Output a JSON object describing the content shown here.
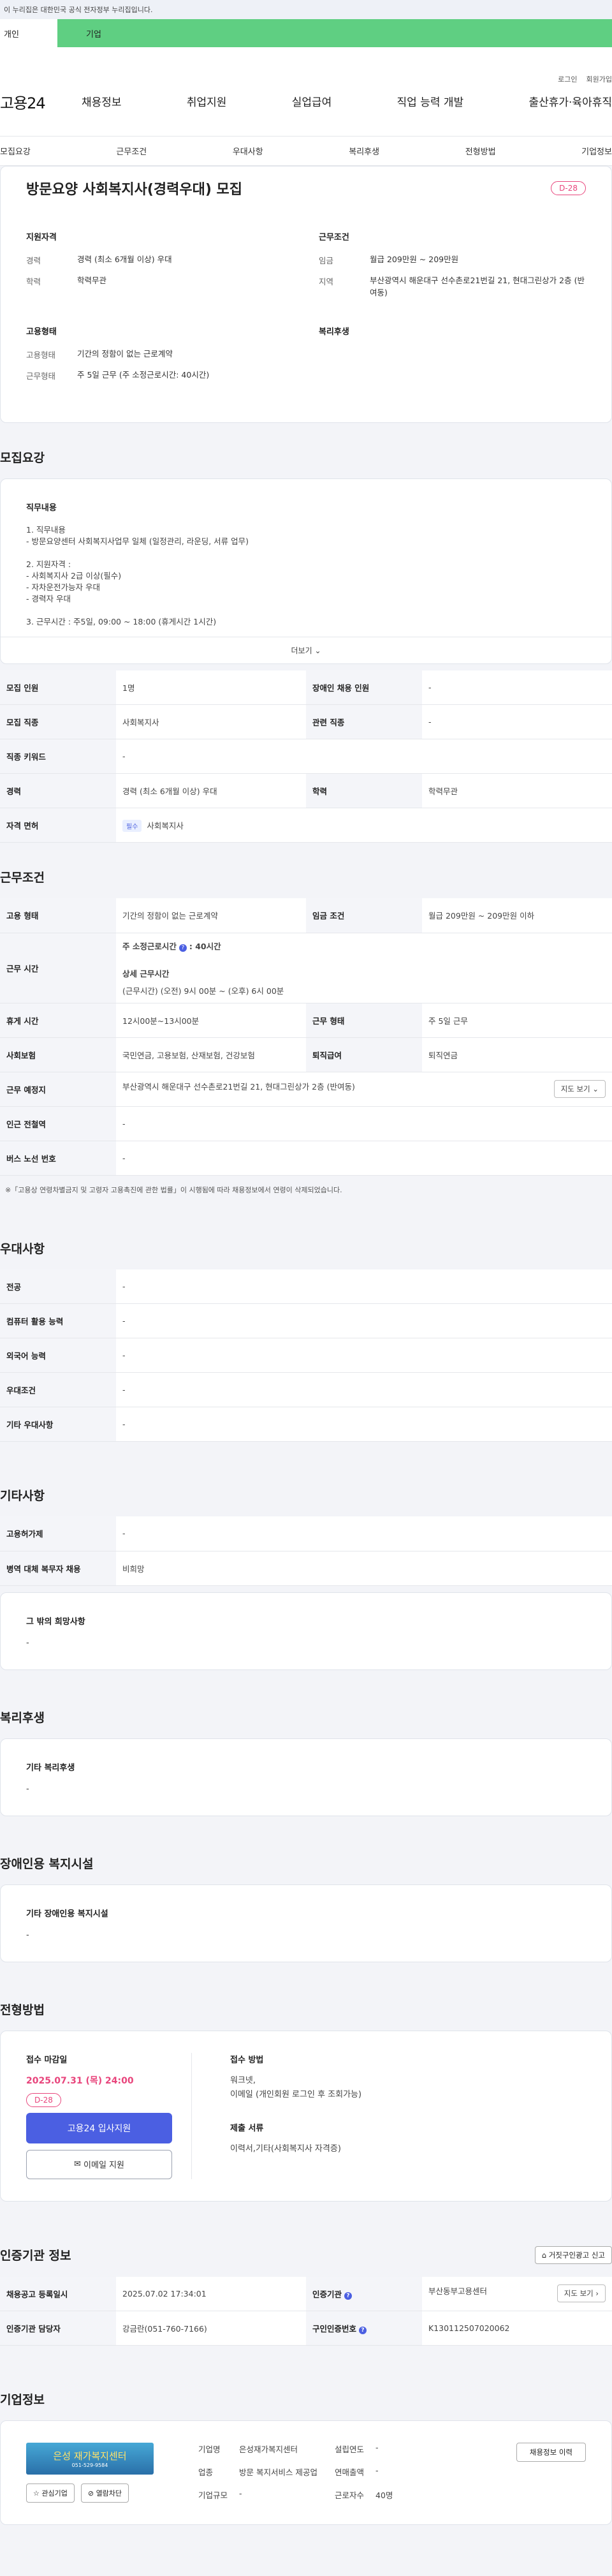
{
  "gov_bar": {
    "text": "이 누리집은 대한민국 공식 전자정부 누리집입니다."
  },
  "type_tabs": {
    "personal": "개인",
    "business": "기업"
  },
  "util": {
    "login": "로그인",
    "join": "회원가입"
  },
  "logo": "고용24",
  "gnb": [
    "채용정보",
    "취업지원",
    "실업급여",
    "직업 능력 개발",
    "출산휴가·육아휴직"
  ],
  "subnav": [
    "모집요강",
    "근무조건",
    "우대사항",
    "복리후생",
    "전형방법",
    "기업정보"
  ],
  "hero": {
    "title": "방문요양 사회복지사(경력우대) 모집",
    "dday": "D-28",
    "qualification_head": "지원자격",
    "conditions_head": "근무조건",
    "employment_head": "고용형태",
    "welfare_head": "복리후생",
    "career_k": "경력",
    "career_v": "경력 (최소 6개월 이상) 우대",
    "edu_k": "학력",
    "edu_v": "학력무관",
    "wage_k": "임금",
    "wage_v": "월급 209만원 ~ 209만원",
    "region_k": "지역",
    "region_v": "부산광역시 해운대구 선수촌로21번길 21, 현대그린상가 2층 (반여동)",
    "emp_k": "고용형태",
    "emp_v": "기간의 정함이 없는 근로계약",
    "form_k": "근무형태",
    "form_v": "주 5일 근무 (주 소정근로시간: 40시간)"
  },
  "recruit": {
    "title": "모집요강",
    "desc_head": "직무내용",
    "lines": [
      "1. 직무내용",
      "- 방문요양센터 사회복지사업무 일체 (일정관리, 라운딩, 서류 업무)",
      "",
      "2. 지원자격 :",
      "- 사회복지사 2급 이상(필수)",
      "- 자차운전가능자 우대",
      "- 경력자 우대",
      "",
      "3. 근무시간 : 주5일, 09:00 ~ 18:00 (휴게시간 1시간)"
    ],
    "more": "더보기",
    "table": {
      "count_k": "모집 인원",
      "count_v": "1명",
      "disabled_k": "장애인 채용 인원",
      "disabled_v": "-",
      "job_k": "모집 직종",
      "job_v": "사회복지사",
      "related_k": "관련 직종",
      "related_v": "-",
      "keyword_k": "직종 키워드",
      "keyword_v": "-",
      "career_k": "경력",
      "career_v": "경력 (최소 6개월 이상) 우대",
      "edu_k": "학력",
      "edu_v": "학력무관",
      "license_k": "자격 면허",
      "license_badge": "필수",
      "license_v": "사회복지사"
    }
  },
  "conditions": {
    "title": "근무조건",
    "emp_k": "고용 형태",
    "emp_v": "기간의 정함이 없는 근로계약",
    "wage_k": "임금 조건",
    "wage_v": "월급 209만원 ~ 209만원 이하",
    "time_k": "근무 시간",
    "time_week_label": "주 소정근로시간",
    "time_week_v": ": 40시간",
    "time_detail_label": "상세 근무시간",
    "time_detail_v": "(근무시간) (오전) 9시 00분 ~ (오후) 6시 00분",
    "rest_k": "휴게 시간",
    "rest_v": "12시00분~13시00분",
    "form_k": "근무 형태",
    "form_v": "주 5일 근무",
    "ins_k": "사회보험",
    "ins_v": "국민연금, 고용보험, 산재보험, 건강보험",
    "retire_k": "퇴직급여",
    "retire_v": "퇴직연금",
    "place_k": "근무 예정지",
    "place_v": "부산광역시 해운대구 선수촌로21번길 21, 현대그린상가 2층 (반여동)",
    "map_btn": "지도 보기",
    "subway_k": "인근 전철역",
    "subway_v": "-",
    "bus_k": "버스 노선 번호",
    "bus_v": "-",
    "note": "※「고용상 연령차별금지 및 고령자 고용촉진에 관한 법률」이 시행됨에 따라 채용정보에서 연령이 삭제되었습니다."
  },
  "preference": {
    "title": "우대사항",
    "major_k": "전공",
    "major_v": "-",
    "pc_k": "컴퓨터 활용 능력",
    "pc_v": "-",
    "lang_k": "외국어 능력",
    "lang_v": "-",
    "cond_k": "우대조건",
    "cond_v": "-",
    "etc_k": "기타 우대사항",
    "etc_v": "-"
  },
  "other": {
    "title": "기타사항",
    "permit_k": "고용허가제",
    "permit_v": "-",
    "military_k": "병역 대체 복무자 채용",
    "military_v": "비희망",
    "hope_head": "그 밖의 희망사항",
    "hope_v": "-"
  },
  "welfare": {
    "title": "복리후생",
    "head": "기타 복리후생",
    "v": "-"
  },
  "disabled": {
    "title": "장애인용 복지시설",
    "head": "기타 장애인용 복지시설",
    "v": "-"
  },
  "apply": {
    "title": "전형방법",
    "deadline_label": "접수 마감일",
    "deadline": "2025.07.31 (목) 24:00",
    "dday": "D-28",
    "btn_apply": "고용24 입사지원",
    "btn_email": "이메일 지원",
    "method_label": "접수 방법",
    "method_lines": [
      "워크넷,",
      "이메일 (개인회원 로그인 후 조회가능)"
    ],
    "docs_label": "제출 서류",
    "docs_v": "이력서,기타(사회복지사 자격증)"
  },
  "agency": {
    "title": "인증기관 정보",
    "report_btn": "거짓구인광고 신고",
    "reg_k": "채용공고 등록일시",
    "reg_v": "2025.07.02 17:34:01",
    "org_k": "인증기관",
    "org_v": "부산동부고용센터",
    "map_btn": "지도 보기",
    "person_k": "인증기관 담당자",
    "person_v": "강금란(051-760-7166)",
    "id_k": "구인인증번호",
    "id_v": "K130112507020062"
  },
  "company": {
    "title": "기업정보",
    "logo_main": "은성 재가복지센터",
    "logo_sub": "051-529-9584",
    "btn_interest": "관심기업",
    "btn_block": "열람차단",
    "name_k": "기업명",
    "name_v": "은성재가복지센터",
    "year_k": "설립연도",
    "year_v": "-",
    "biz_k": "업종",
    "biz_v": "방문 복지서비스 제공업",
    "sales_k": "연매출액",
    "sales_v": "-",
    "size_k": "기업규모",
    "size_v": "-",
    "staff_k": "근로자수",
    "staff_v": "40명",
    "history_btn": "채용정보 이력"
  },
  "colors": {
    "accent": "#4b5fe2",
    "dday": "#e8457c",
    "biz_tab": "#5fcf82"
  }
}
